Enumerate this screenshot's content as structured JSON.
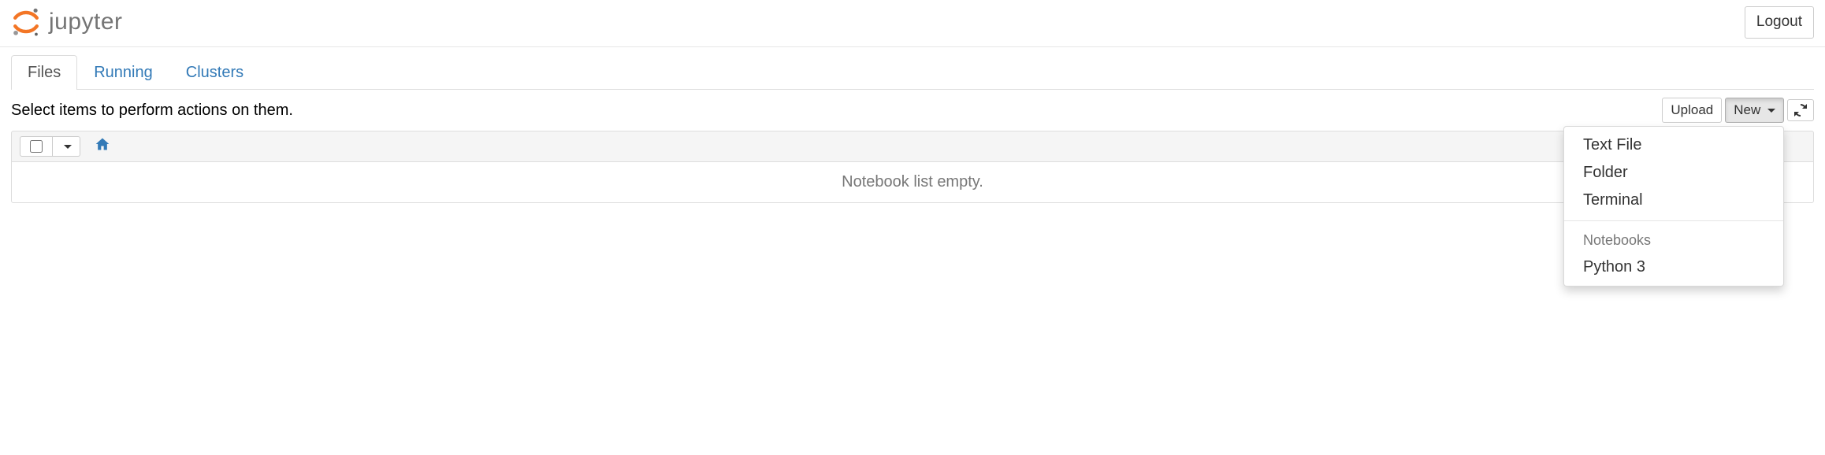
{
  "header": {
    "brand": "jupyter",
    "logout_label": "Logout"
  },
  "tabs": {
    "items": [
      {
        "label": "Files",
        "active": true
      },
      {
        "label": "Running",
        "active": false
      },
      {
        "label": "Clusters",
        "active": false
      }
    ]
  },
  "toolbar": {
    "hint": "Select items to perform actions on them.",
    "upload_label": "Upload",
    "new_label": "New"
  },
  "new_menu": {
    "items": [
      {
        "label": "Text File"
      },
      {
        "label": "Folder"
      },
      {
        "label": "Terminal"
      }
    ],
    "section_header": "Notebooks",
    "notebook_items": [
      {
        "label": "Python 3"
      }
    ]
  },
  "list": {
    "empty_text": "Notebook list empty."
  }
}
